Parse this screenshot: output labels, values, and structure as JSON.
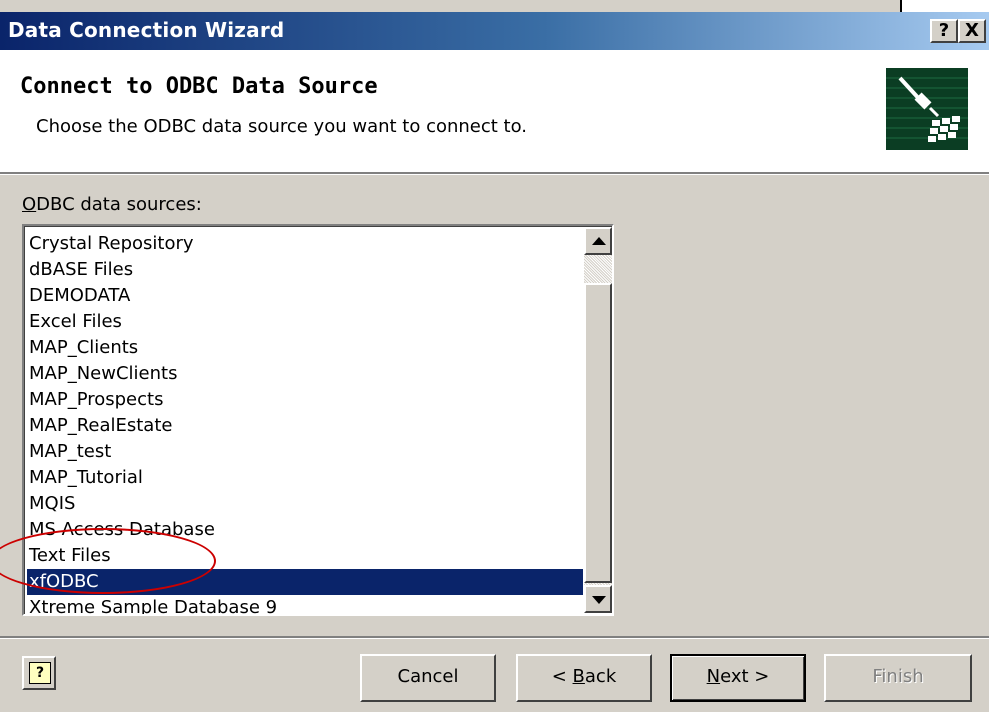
{
  "window": {
    "title": "Data Connection Wizard",
    "help_glyph": "?",
    "close_glyph": "X"
  },
  "header": {
    "title": "Connect to ODBC Data Source",
    "subtitle": "Choose the ODBC data source you want to connect to.",
    "icon": "data-connection-plug-icon"
  },
  "list": {
    "label_prefix": "O",
    "label_rest": "DBC data sources:",
    "items": [
      "Crystal Repository",
      "dBASE Files",
      "DEMODATA",
      "Excel Files",
      "MAP_Clients",
      "MAP_NewClients",
      "MAP_Prospects",
      "MAP_RealEstate",
      "MAP_test",
      "MAP_Tutorial",
      "MQIS",
      "MS Access Database",
      "Text Files",
      "xfODBC",
      "Xtreme Sample Database 9"
    ],
    "selected_index": 13,
    "annotation_color": "#cc0000"
  },
  "buttons": {
    "help_glyph": "?",
    "cancel": "Cancel",
    "back_pre": "< ",
    "back_u": "B",
    "back_rest": "ack",
    "next_u": "N",
    "next_rest": "ext >",
    "finish": "Finish"
  },
  "colors": {
    "selection": "#0a246a",
    "titlebar_start": "#0a246a",
    "titlebar_end": "#a6caf0"
  }
}
